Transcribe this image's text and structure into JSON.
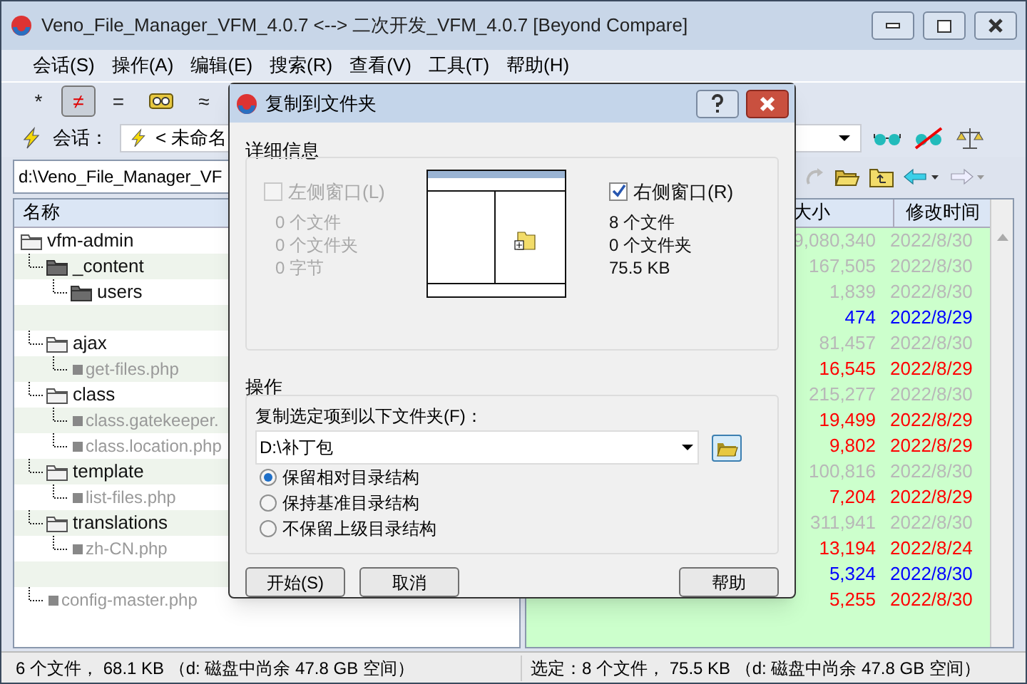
{
  "window": {
    "title": "Veno_File_Manager_VFM_4.0.7  <-->  二次开发_VFM_4.0.7  [Beyond Compare]"
  },
  "menu": [
    "会话(S)",
    "操作(A)",
    "编辑(E)",
    "搜索(R)",
    "查看(V)",
    "工具(T)",
    "帮助(H)"
  ],
  "toolbar": {
    "items": [
      {
        "kind": "text",
        "label": "*",
        "selected": false
      },
      {
        "kind": "text",
        "label": "≠",
        "selected": true
      },
      {
        "kind": "text",
        "label": "=",
        "selected": false
      },
      {
        "kind": "icon",
        "selected": false
      },
      {
        "kind": "text",
        "label": "≈",
        "selected": false
      }
    ]
  },
  "session": {
    "label": "会话：",
    "value": "< 未命名"
  },
  "left_path": "d:\\Veno_File_Manager_VF",
  "left_pane": {
    "columns": [
      "名称"
    ],
    "tree": [
      {
        "kind": "folder",
        "name": "vfm-admin",
        "children": [
          {
            "kind": "dark_folder",
            "name": "_content",
            "children": [
              {
                "kind": "dark_folder",
                "name": "users"
              }
            ]
          },
          {
            "kind": "blank"
          },
          {
            "kind": "folder",
            "name": "ajax",
            "children": [
              {
                "kind": "file",
                "name": "get-files.php"
              }
            ]
          },
          {
            "kind": "folder",
            "name": "class",
            "children": [
              {
                "kind": "file",
                "name": "class.gatekeeper."
              },
              {
                "kind": "file",
                "name": "class.location.php"
              }
            ]
          },
          {
            "kind": "folder",
            "name": "template",
            "children": [
              {
                "kind": "file",
                "name": "list-files.php"
              }
            ]
          },
          {
            "kind": "folder",
            "name": "translations",
            "children": [
              {
                "kind": "file",
                "name": "zh-CN.php"
              }
            ]
          },
          {
            "kind": "blank"
          },
          {
            "kind": "file",
            "name": "config-master.php"
          }
        ]
      }
    ]
  },
  "right_pane": {
    "columns": [
      "大小",
      "修改时间"
    ],
    "rows": [
      {
        "kind": "same",
        "size": "9,080,340",
        "date": "2022/8/30"
      },
      {
        "kind": "same",
        "size": "167,505",
        "date": "2022/8/30"
      },
      {
        "kind": "same",
        "size": "1,839",
        "date": "2022/8/30"
      },
      {
        "kind": "newer",
        "size": "474",
        "date": "2022/8/29"
      },
      {
        "kind": "same",
        "size": "81,457",
        "date": "2022/8/30"
      },
      {
        "kind": "differ",
        "size": "16,545",
        "date": "2022/8/29"
      },
      {
        "kind": "same",
        "size": "215,277",
        "date": "2022/8/30"
      },
      {
        "kind": "differ",
        "size": "19,499",
        "date": "2022/8/29"
      },
      {
        "kind": "differ",
        "size": "9,802",
        "date": "2022/8/29"
      },
      {
        "kind": "same",
        "size": "100,816",
        "date": "2022/8/30"
      },
      {
        "kind": "differ",
        "size": "7,204",
        "date": "2022/8/29"
      },
      {
        "kind": "same",
        "size": "311,941",
        "date": "2022/8/30"
      },
      {
        "kind": "differ",
        "size": "13,194",
        "date": "2022/8/24"
      },
      {
        "kind": "newer",
        "size": "5,324",
        "date": "2022/8/30"
      },
      {
        "kind": "differ",
        "size": "5,255",
        "date": "2022/8/30"
      }
    ]
  },
  "status_bar": {
    "left": "6 个文件， 68.1 KB （d: 磁盘中尚余 47.8 GB 空间）",
    "right": "选定：8 个文件， 75.5 KB （d: 磁盘中尚余 47.8 GB 空间）"
  },
  "dialog": {
    "title": "复制到文件夹",
    "details_title": "详细信息",
    "left": {
      "label": "左侧窗口(L)",
      "checked": false,
      "disabled": true,
      "stats": [
        "0 个文件",
        "0 个文件夹",
        "0 字节"
      ]
    },
    "right": {
      "label": "右侧窗口(R)",
      "checked": true,
      "disabled": false,
      "stats": [
        "8 个文件",
        "0 个文件夹",
        "75.5 KB"
      ]
    },
    "operation_title": "操作",
    "target_label": "复制选定项到以下文件夹(F)：",
    "target": "D:\\补丁包",
    "options": [
      {
        "label": "保留相对目录结构",
        "selected": true
      },
      {
        "label": "保持基准目录结构",
        "selected": false
      },
      {
        "label": "不保留上级目录结构",
        "selected": false
      }
    ],
    "buttons": [
      "开始(S)",
      "取消",
      "帮助"
    ]
  }
}
